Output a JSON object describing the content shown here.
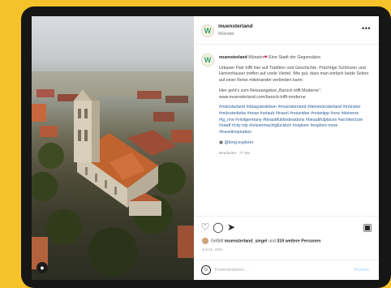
{
  "colors": {
    "background": "#f5c22a",
    "device": "#161616",
    "link": "#2f5e96",
    "post_button": "#b3dbff"
  },
  "header": {
    "username": "muensterland",
    "location": "Münster",
    "avatar_letter": "W",
    "more_icon": "more-horizontal-icon"
  },
  "photo": {
    "user_tag_icon": "person-icon"
  },
  "caption": {
    "username": "muensterland",
    "headline": "Münster",
    "headline_rest": " Eine Stadt der Gegensätze.",
    "heart_icon": "heart-icon",
    "paragraph1": "Urbaner Flair trifft hier auf Tradition und Geschichte. Prächtige Schlösser und Herrenhäuser treffen auf coole Viertel. Wie gut, dass man einfach beide Seiten auf einer Reise miteinander verbinden kann:",
    "paragraph2": "Hier geht's zum Reiseangebot „Barock trifft Moderne“: www.muensterland.com/barock-trifft-moderne",
    "hashtags": "#münsterland #dasgutesleben #muensterland #deinmünsterland #münster #münsterliebe #reise #urlaub #travel #reiseidee #reisetipp #nrw #deinnrw #ig_nrw #visitgermany #beautifuldestinations #beautifulplaces #architecture #stadt #city trip #reisenmachtglücklich #explore #explore more #travelinspiration",
    "credit": "@long.explorer",
    "credit_icon": "camera-icon",
    "meta": "Bearbeitet · 77 Wo."
  },
  "actions": {
    "like_icon": "heart-outline-icon",
    "comment_icon": "comment-icon",
    "share_icon": "send-icon",
    "save_icon": "bookmark-icon",
    "likes_prefix": "Gefällt ",
    "likes_user": "muensterland_siegel",
    "likes_middle": " und ",
    "likes_count": "319 weitere Personen",
    "date": "Juli 21, 2022"
  },
  "comment": {
    "emoji_icon": "smiley-icon",
    "placeholder": "Kommentieren ...",
    "post_label": "Posten"
  }
}
